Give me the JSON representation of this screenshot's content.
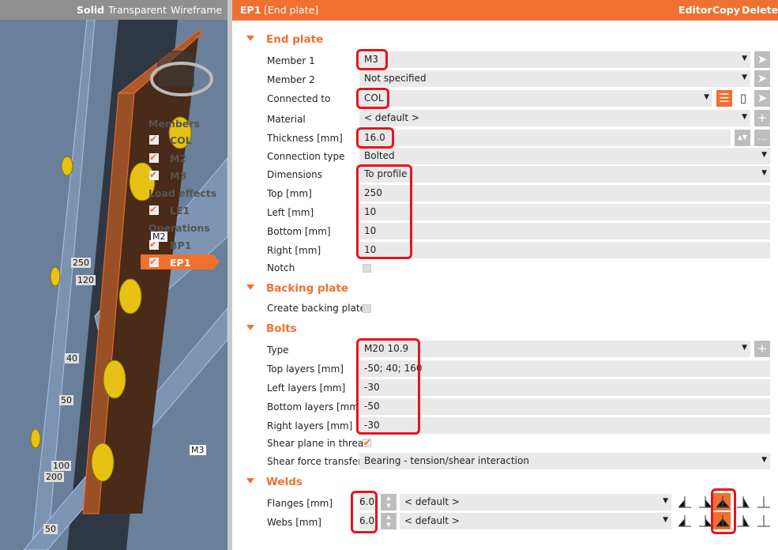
{
  "view": {
    "modes": [
      "Solid",
      "Transparent",
      "Wireframe"
    ],
    "tree": {
      "members_title": "Members",
      "members": [
        "COL",
        "M2",
        "M3"
      ],
      "load_title": "Load effects",
      "loads": [
        "LE1"
      ],
      "ops_title": "Operations",
      "ops": [
        "BP1",
        "EP1"
      ]
    },
    "labels": [
      "M2",
      "M3"
    ],
    "dims": [
      "250",
      "120",
      "40",
      "50",
      "100",
      "200",
      "50"
    ]
  },
  "header": {
    "id": "EP1",
    "name": "[End plate]",
    "editor": "Editor",
    "copy": "Copy",
    "delete": "Delete"
  },
  "end_plate": {
    "title": "End plate",
    "member1": {
      "label": "Member 1",
      "value": "M3"
    },
    "member2": {
      "label": "Member 2",
      "value": "Not specified"
    },
    "connected_to": {
      "label": "Connected to",
      "value": "COL"
    },
    "material": {
      "label": "Material",
      "value": "< default >"
    },
    "thickness": {
      "label": "Thickness [mm]",
      "value": "16.0"
    },
    "connection_type": {
      "label": "Connection type",
      "value": "Bolted"
    },
    "dimensions": {
      "label": "Dimensions",
      "value": "To profile"
    },
    "top": {
      "label": "Top [mm]",
      "value": "250"
    },
    "left": {
      "label": "Left [mm]",
      "value": "10"
    },
    "bottom": {
      "label": "Bottom [mm]",
      "value": "10"
    },
    "right": {
      "label": "Right [mm]",
      "value": "10"
    },
    "notch": {
      "label": "Notch"
    }
  },
  "backing": {
    "title": "Backing plate",
    "create": {
      "label": "Create backing plate"
    }
  },
  "bolts": {
    "title": "Bolts",
    "type": {
      "label": "Type",
      "value": "M20 10.9"
    },
    "top": {
      "label": "Top layers [mm]",
      "value": "-50; 40; 160"
    },
    "left": {
      "label": "Left layers [mm]",
      "value": "-30"
    },
    "bottom": {
      "label": "Bottom layers [mm]",
      "value": "-50"
    },
    "right": {
      "label": "Right layers [mm]",
      "value": "-30"
    },
    "shear_plane": {
      "label": "Shear plane in thread"
    },
    "shear_force": {
      "label": "Shear force transfer",
      "value": "Bearing - tension/shear interaction"
    }
  },
  "welds": {
    "title": "Welds",
    "flanges": {
      "label": "Flanges [mm]",
      "size": "6.0",
      "material": "< default >"
    },
    "webs": {
      "label": "Webs [mm]",
      "size": "6.0",
      "material": "< default >"
    }
  },
  "colors": {
    "accent": "#f07030",
    "highlight": "#e8141b"
  }
}
